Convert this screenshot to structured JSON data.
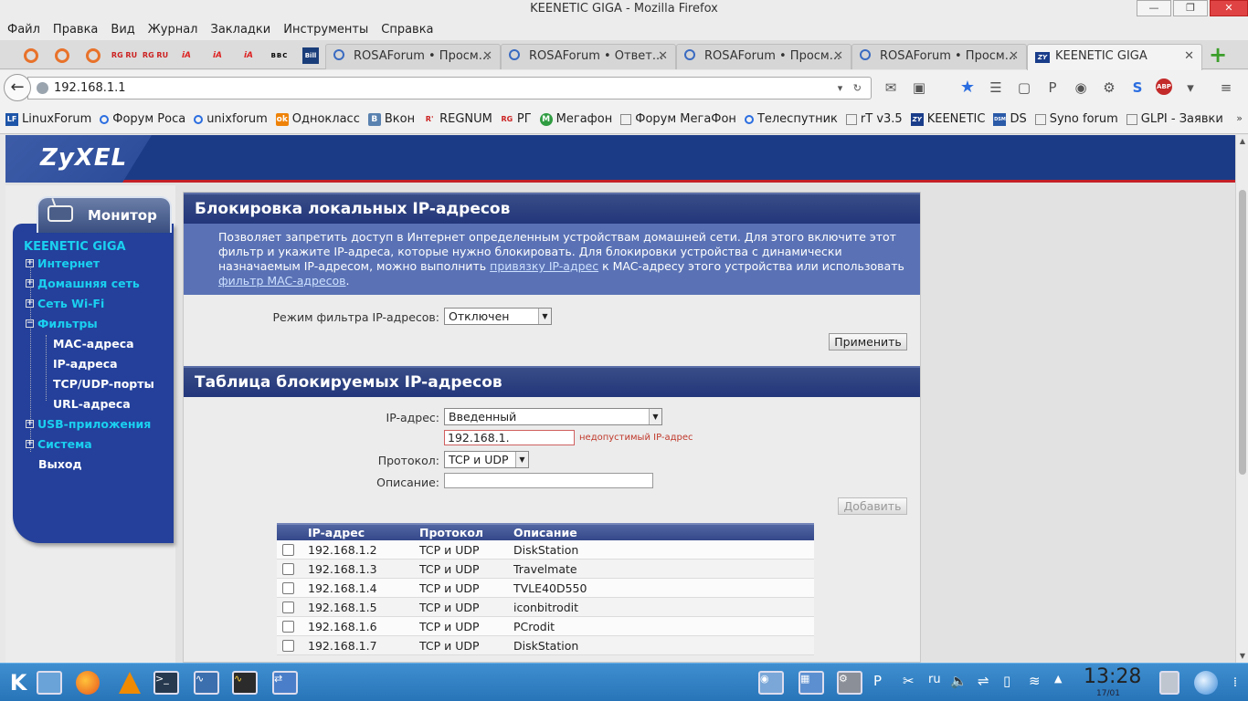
{
  "window": {
    "title": "KEENETIC GIGA - Mozilla Firefox",
    "minimize": "—",
    "maximize": "❐",
    "close": "✕"
  },
  "menu": [
    "Файл",
    "Правка",
    "Вид",
    "Журнал",
    "Закладки",
    "Инструменты",
    "Справка"
  ],
  "pinned_tabs": [
    {
      "icon": "opera-icon",
      "label": ""
    },
    {
      "icon": "opera-icon",
      "label": ""
    },
    {
      "icon": "opera-icon",
      "label": ""
    },
    {
      "icon": "rg-icon",
      "label": "RG\nRU"
    },
    {
      "icon": "rg-icon",
      "label": "RG\nRU"
    },
    {
      "icon": "ia-icon",
      "label": "iA"
    },
    {
      "icon": "ia-icon",
      "label": "iA"
    },
    {
      "icon": "ia-icon",
      "label": "iA"
    },
    {
      "icon": "bbc-icon",
      "label": "BBC"
    },
    {
      "icon": "bill-icon",
      "label": "Bill"
    }
  ],
  "tabs": [
    {
      "title": "ROSAForum • Просм...",
      "active": false
    },
    {
      "title": "ROSAForum • Ответ...",
      "active": false
    },
    {
      "title": "ROSAForum • Просм...",
      "active": false
    },
    {
      "title": "ROSAForum • Просм...",
      "active": false
    },
    {
      "title": "KEENETIC GIGA",
      "active": true
    }
  ],
  "newtab": "+",
  "url": "192.168.1.1",
  "url_controls": "▾ ↻",
  "bookmarks": [
    {
      "label": "LinuxForum",
      "icon": "lf",
      "icon_text": "LF"
    },
    {
      "label": "Форум Роса",
      "icon": "circ",
      "icon_text": ""
    },
    {
      "label": "unixforum",
      "icon": "circ",
      "icon_text": ""
    },
    {
      "label": "Однокласс",
      "icon": "ok",
      "icon_text": "ok"
    },
    {
      "label": "Вкон",
      "icon": "vk",
      "icon_text": "B"
    },
    {
      "label": "REGNUM",
      "icon": "rg2",
      "icon_text": "R'"
    },
    {
      "label": "РГ",
      "icon": "rg2",
      "icon_text": "RG"
    },
    {
      "label": "Мегафон",
      "icon": "mega",
      "icon_text": "M"
    },
    {
      "label": "Форум МегаФон",
      "icon": "sq",
      "icon_text": ""
    },
    {
      "label": "Телеспутник",
      "icon": "circ",
      "icon_text": ""
    },
    {
      "label": "rT v3.5",
      "icon": "sq",
      "icon_text": ""
    },
    {
      "label": "KEENETIC",
      "icon": "zy",
      "icon_text": "ZY"
    },
    {
      "label": "DS",
      "icon": "dsm",
      "icon_text": "DSM"
    },
    {
      "label": "Syno forum",
      "icon": "sq",
      "icon_text": ""
    },
    {
      "label": "GLPI - Заявки",
      "icon": "sq",
      "icon_text": ""
    }
  ],
  "bookmarks_more": "»",
  "zyxel": {
    "logo": "ZyXEL"
  },
  "sidebar": {
    "tab_label": "Монитор",
    "title": "KEENETIC GIGA",
    "items": [
      {
        "label": "Интернет",
        "expander": "+"
      },
      {
        "label": "Домашняя сеть",
        "expander": "+"
      },
      {
        "label": "Сеть Wi-Fi",
        "expander": "+"
      },
      {
        "label": "Фильтры",
        "expander": "−"
      }
    ],
    "subitems": [
      "MAC-адреса",
      "IP-адреса",
      "TCP/UDP-порты",
      "URL-адреса"
    ],
    "items2": [
      {
        "label": "USB-приложения",
        "expander": "+"
      },
      {
        "label": "Система",
        "expander": "+"
      }
    ],
    "exit": "Выход"
  },
  "section1": {
    "title": "Блокировка локальных IP-адресов",
    "desc_1": "Позволяет запретить доступ в Интернет определенным устройствам домашней сети. Для этого включите этот фильтр и укажите IP-адреса, которые нужно блокировать. Для блокировки устройства с динамически назначаемым IP-адресом, можно выполнить ",
    "desc_link1": "привязку IP-адрес",
    "desc_2": " к MAC-адресу этого устройства или использовать ",
    "desc_link2": "фильтр MAC-адресов",
    "desc_3": ".",
    "mode_label": "Режим фильтра IP-адресов:",
    "mode_value": "Отключен",
    "apply": "Применить"
  },
  "section2": {
    "title": "Таблица блокируемых IP-адресов",
    "ip_label": "IP-адрес:",
    "ip_mode": "Введенный",
    "ip_value": "192.168.1.",
    "ip_error": "недопустимый IP-адрес",
    "proto_label": "Протокол:",
    "proto_value": "TCP и UDP",
    "desc_label": "Описание:",
    "desc_value": "",
    "add": "Добавить"
  },
  "table": {
    "headers": [
      "IP-адрес",
      "Протокол",
      "Описание"
    ],
    "rows": [
      [
        "192.168.1.2",
        "TCP и UDP",
        "DiskStation"
      ],
      [
        "192.168.1.3",
        "TCP и UDP",
        "Travelmate"
      ],
      [
        "192.168.1.4",
        "TCP и UDP",
        "TVLE40D550"
      ],
      [
        "192.168.1.5",
        "TCP и UDP",
        "iconbitrodit"
      ],
      [
        "192.168.1.6",
        "TCP и UDP",
        "PCrodit"
      ],
      [
        "192.168.1.7",
        "TCP и UDP",
        "DiskStation"
      ]
    ]
  },
  "taskbar": {
    "time": "13:28",
    "date": "17/01",
    "lang": "ru"
  }
}
